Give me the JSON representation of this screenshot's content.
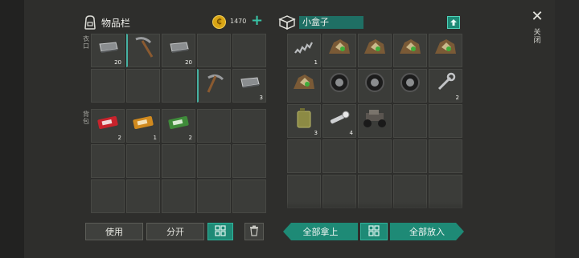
{
  "inventory": {
    "title": "物品栏",
    "coins": "1470",
    "add_symbol": "+",
    "pocket_label": "衣口",
    "backpack_label": "背包",
    "pocket_counts": [
      "20",
      "",
      "20",
      "",
      "",
      "",
      "",
      "",
      "",
      "3"
    ],
    "backpack_counts": [
      "2",
      "1",
      "2"
    ]
  },
  "container": {
    "title": "小盒子",
    "counts": [
      "1",
      "",
      "",
      "",
      "",
      "",
      "",
      "",
      "",
      "2",
      "3",
      "4"
    ]
  },
  "buttons": {
    "use": "使用",
    "split": "分开",
    "take_all": "全部拿上",
    "put_all": "全部放入"
  },
  "close": {
    "symbol": "✕",
    "label": "关闭"
  },
  "colors": {
    "accent": "#1e8a76",
    "accent_light": "#46b1a2",
    "coin": "#d9a514",
    "slot": "#3b3c39",
    "background": "#2e2e2c"
  }
}
